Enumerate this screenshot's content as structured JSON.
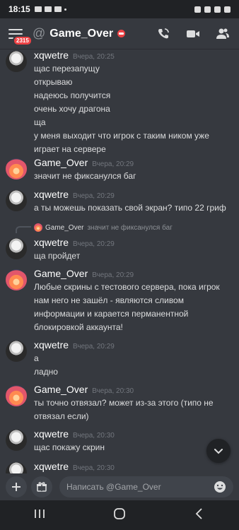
{
  "status": {
    "time": "18:15"
  },
  "header": {
    "at_symbol": "@",
    "title": "Game_Over",
    "menu_badge": "2315"
  },
  "messages": [
    {
      "author": "xqwetre",
      "time": "Вчера, 20:25",
      "lines": [
        "щас перезапущу",
        "открываю",
        "надеюсь получится",
        "очень хочу драгона",
        "ща",
        "у меня выходит что игрок с таким ником уже",
        "играет на сервере"
      ]
    },
    {
      "author": "Game_Over",
      "time": "Вчера, 20:29",
      "lines": [
        "значит не фиксанулся баг"
      ]
    },
    {
      "author": "xqwetre",
      "time": "Вчера, 20:29",
      "lines": [
        "а ты можешь показать свой экран? типо 22 гриф"
      ]
    },
    {
      "author": "xqwetre",
      "time": "Вчера, 20:29",
      "lines": [
        "ща пройдет"
      ]
    },
    {
      "author": "Game_Over",
      "time": "Вчера, 20:29",
      "lines": [
        "Любые скрины с тестового сервера, пока игрок",
        "нам него не зашёл - являются сливом",
        "информации и карается перманентной",
        "блокировкой аккаунта!"
      ]
    },
    {
      "author": "xqwetre",
      "time": "Вчера, 20:29",
      "lines": [
        "а",
        "ладно"
      ]
    },
    {
      "author": "Game_Over",
      "time": "Вчера, 20:30",
      "lines": [
        "ты точно отвязал? может из-за этого (типо не",
        "отвязал если)"
      ]
    },
    {
      "author": "xqwetre",
      "time": "Вчера, 20:30",
      "lines": [
        "щас покажу скрин"
      ]
    },
    {
      "author": "xqwetre",
      "time": "Вчера, 20:30",
      "lines": []
    }
  ],
  "reply": {
    "author": "Game_Over",
    "text": "значит не фиксанулся баг"
  },
  "composer": {
    "placeholder": "Написать @Game_Over"
  },
  "colors": {
    "background": "#36393f",
    "dark": "#202225",
    "text": "#dcddde",
    "muted": "#72767d",
    "danger": "#ed4245"
  }
}
